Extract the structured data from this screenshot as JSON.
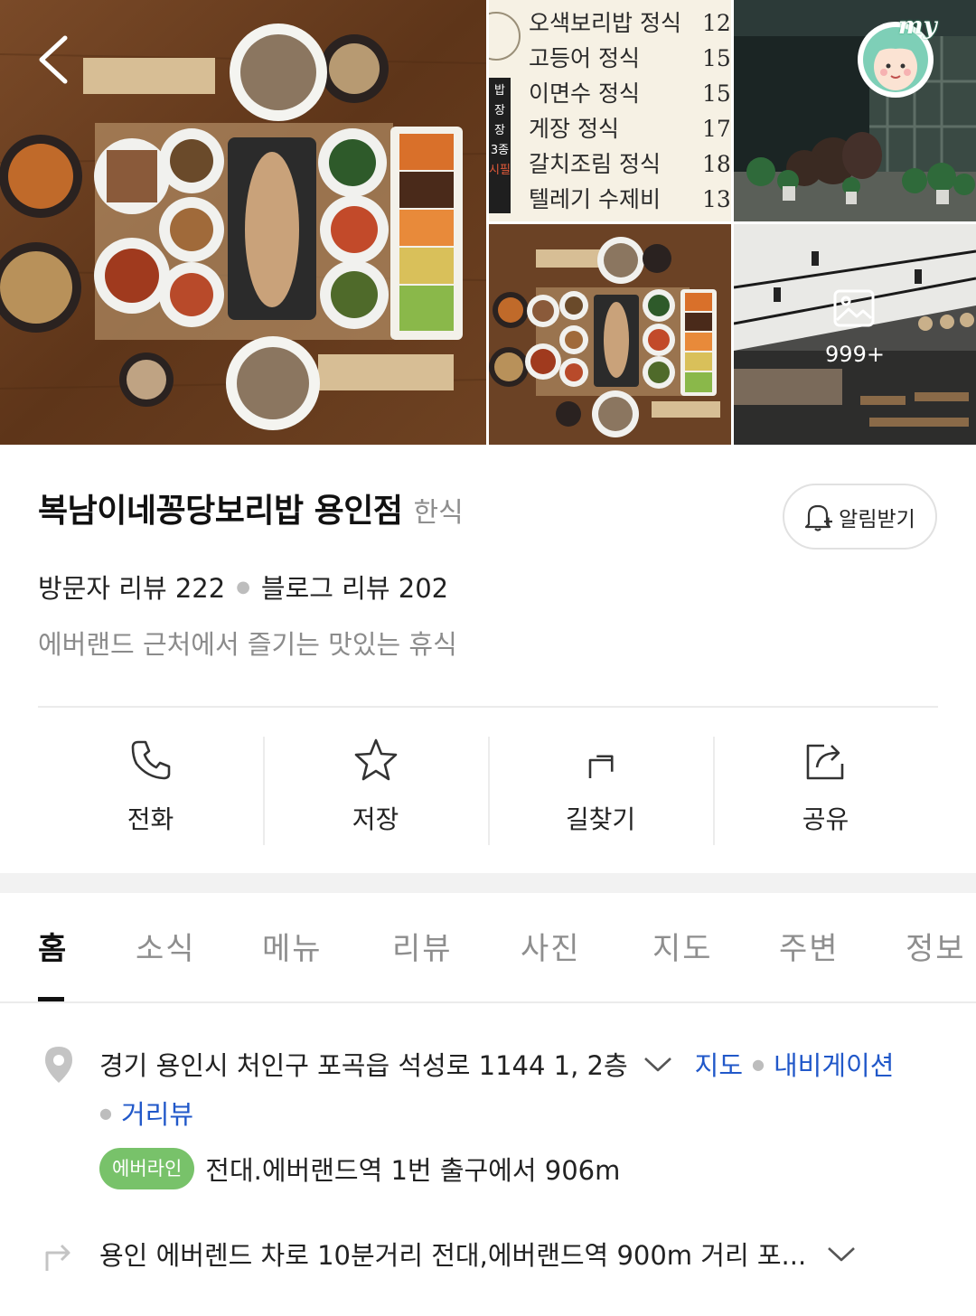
{
  "photos": {
    "menu_items": [
      {
        "name": "오색보리밥 정식",
        "price": "12,"
      },
      {
        "name": "고등어 정식",
        "price": "15,"
      },
      {
        "name": "이면수 정식",
        "price": "15,"
      },
      {
        "name": "게장 정식",
        "price": "17,"
      },
      {
        "name": "갈치조림 정식",
        "price": "18,"
      },
      {
        "name": "텔레기 수제비",
        "price": "13,"
      }
    ],
    "menu_side_text": [
      "밥",
      "장",
      "장",
      "3종",
      "시필"
    ],
    "my_label": "my",
    "photo_count": "999+"
  },
  "place": {
    "name": "복남이네꽁당보리밥 용인점",
    "category": "한식",
    "alarm_label": "알림받기",
    "visitor_reviews": "방문자 리뷰 222",
    "blog_reviews": "블로그 리뷰 202",
    "tagline": "에버랜드 근처에서 즐기는 맛있는 휴식"
  },
  "actions": [
    {
      "label": "전화",
      "icon": "phone-icon"
    },
    {
      "label": "저장",
      "icon": "star-icon"
    },
    {
      "label": "길찾기",
      "icon": "directions-icon"
    },
    {
      "label": "공유",
      "icon": "share-icon"
    }
  ],
  "tabs": [
    "홈",
    "소식",
    "메뉴",
    "리뷰",
    "사진",
    "지도",
    "주변",
    "정보"
  ],
  "info": {
    "address": "경기 용인시 처인구 포곡읍 석성로 1144 1, 2층",
    "map_link": "지도",
    "nav_link": "내비게이션",
    "street_view_link": "거리뷰",
    "subway_line": "에버라인",
    "subway_text": "전대.에버랜드역 1번 출구에서 906m",
    "directions_text": "용인 에버렌드 차로 10분거리 전대,에버랜드역 900m 거리 포..."
  },
  "colors": {
    "link": "#2158c9",
    "subway_badge": "#78c26a",
    "text_primary": "#222222",
    "text_secondary": "#8e8e8e"
  }
}
